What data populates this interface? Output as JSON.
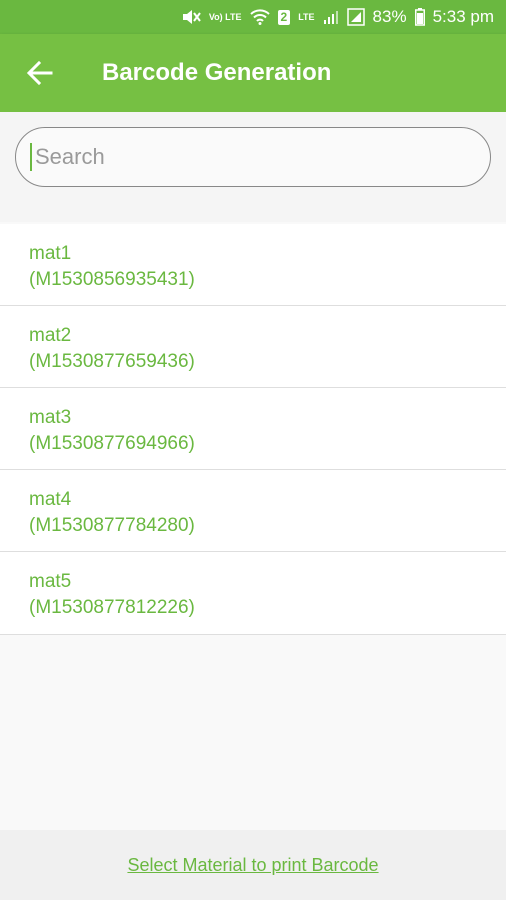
{
  "status_bar": {
    "volte_label": "Vo) LTE",
    "sim_badge": "2",
    "lte_label": "LTE",
    "battery": "83%",
    "time": "5:33 pm"
  },
  "app_bar": {
    "title": "Barcode Generation"
  },
  "search": {
    "placeholder": "Search",
    "value": ""
  },
  "materials": [
    {
      "name": "mat1",
      "code": "(M1530856935431)"
    },
    {
      "name": "mat2",
      "code": "(M1530877659436)"
    },
    {
      "name": "mat3",
      "code": "(M1530877694966)"
    },
    {
      "name": "mat4",
      "code": "(M1530877784280)"
    },
    {
      "name": "mat5",
      "code": "(M1530877812226)"
    }
  ],
  "footer": {
    "link_label": "Select Material to print Barcode"
  },
  "colors": {
    "primary": "#76c043",
    "status_bar": "#6ab840",
    "accent_text": "#6ab840"
  }
}
